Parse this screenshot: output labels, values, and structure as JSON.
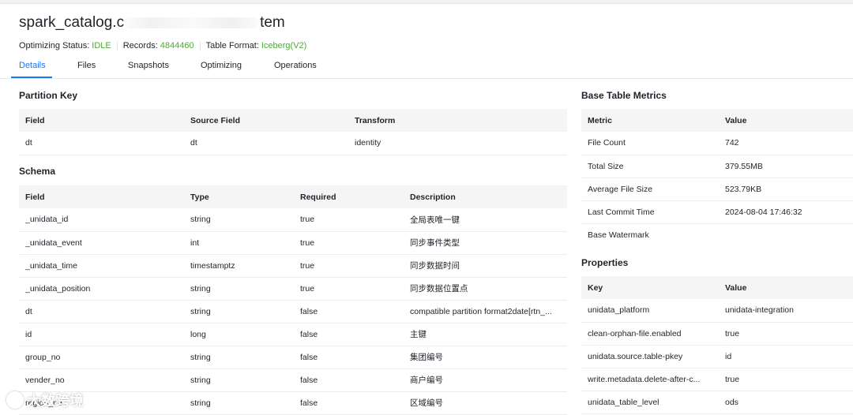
{
  "header": {
    "title_start": "spark_catalog.c",
    "title_end": "tem",
    "optimizing_status_label": "Optimizing Status:",
    "optimizing_status_value": "IDLE",
    "records_label": "Records:",
    "records_value": "4844460",
    "table_format_label": "Table Format:",
    "table_format_value": "Iceberg(V2)"
  },
  "tabs": [
    {
      "label": "Details",
      "active": true
    },
    {
      "label": "Files",
      "active": false
    },
    {
      "label": "Snapshots",
      "active": false
    },
    {
      "label": "Optimizing",
      "active": false
    },
    {
      "label": "Operations",
      "active": false
    }
  ],
  "partition_key": {
    "title": "Partition Key",
    "columns": [
      "Field",
      "Source Field",
      "Transform"
    ],
    "rows": [
      [
        "dt",
        "dt",
        "identity"
      ]
    ]
  },
  "schema": {
    "title": "Schema",
    "columns": [
      "Field",
      "Type",
      "Required",
      "Description"
    ],
    "rows": [
      [
        "_unidata_id",
        "string",
        "true",
        "全局表唯一键"
      ],
      [
        "_unidata_event",
        "int",
        "true",
        "同步事件类型"
      ],
      [
        "_unidata_time",
        "timestamptz",
        "true",
        "同步数据时间"
      ],
      [
        "_unidata_position",
        "string",
        "true",
        "同步数据位置点"
      ],
      [
        "dt",
        "string",
        "false",
        "compatible partition format2date[rtn_..."
      ],
      [
        "id",
        "long",
        "false",
        "主键"
      ],
      [
        "group_no",
        "string",
        "false",
        "集团编号"
      ],
      [
        "vender_no",
        "string",
        "false",
        "商户编号"
      ],
      [
        "region_no",
        "string",
        "false",
        "区域编号"
      ]
    ]
  },
  "metrics": {
    "title": "Base Table Metrics",
    "columns": [
      "Metric",
      "Value"
    ],
    "rows": [
      [
        "File Count",
        "742"
      ],
      [
        "Total Size",
        "379.55MB"
      ],
      [
        "Average File Size",
        "523.79KB"
      ],
      [
        "Last Commit Time",
        "2024-08-04 17:46:32"
      ],
      [
        "Base Watermark",
        ""
      ]
    ]
  },
  "properties": {
    "title": "Properties",
    "columns": [
      "Key",
      "Value"
    ],
    "rows": [
      [
        "unidata_platform",
        "unidata-integration"
      ],
      [
        "clean-orphan-file.enabled",
        "true"
      ],
      [
        "unidata.source.table-pkey",
        "id"
      ],
      [
        "write.metadata.delete-after-c...",
        "true"
      ],
      [
        "unidata_table_level",
        "ods"
      ]
    ]
  },
  "watermark": {
    "text": "大数跨境",
    "icon": "watermark-logo-icon"
  },
  "colors": {
    "accent": "#1677ff",
    "status_green": "#52a73b"
  }
}
